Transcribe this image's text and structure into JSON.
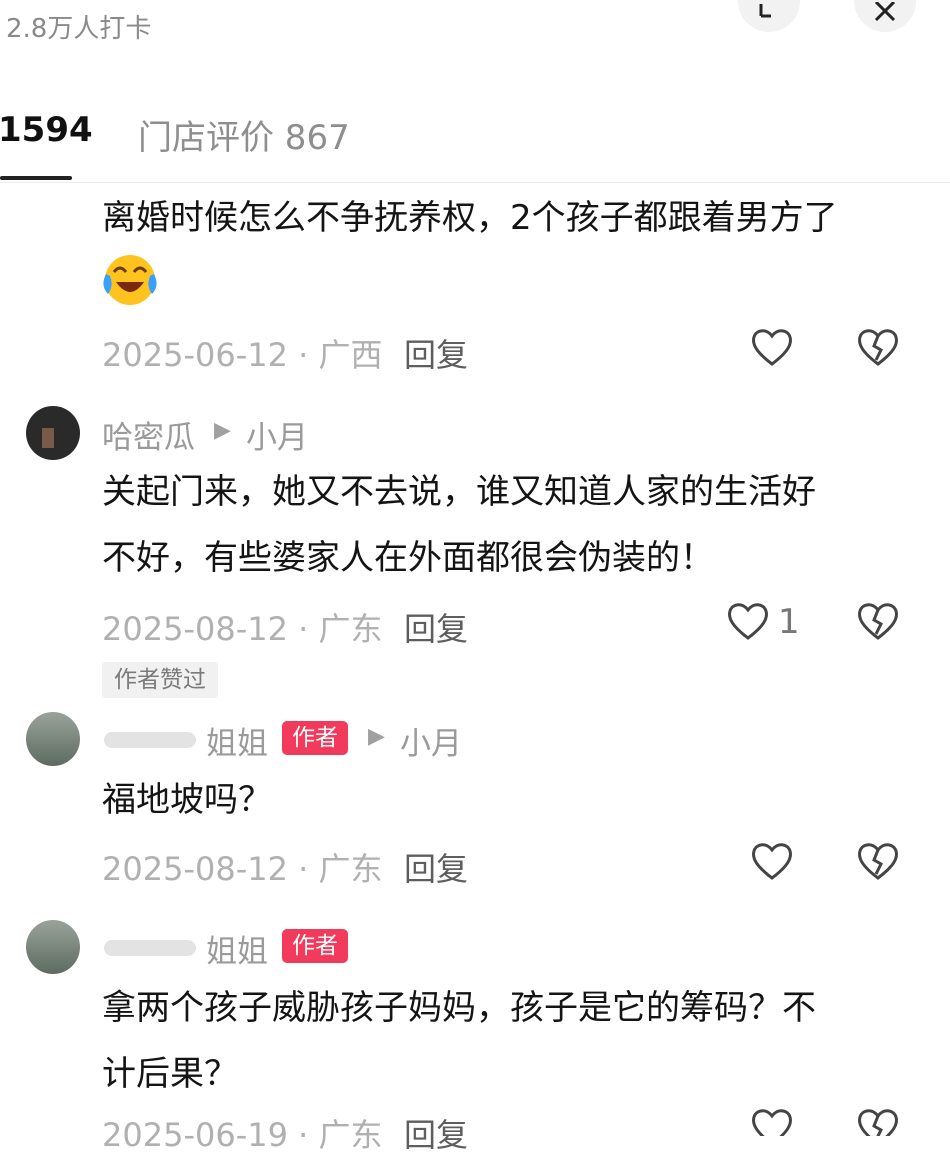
{
  "header": {
    "checkin_text": "2.8万人打卡",
    "share_icon": "share-icon",
    "close_icon": "close-icon",
    "tabs": [
      {
        "label": "1594"
      },
      {
        "label": "门店评价 867"
      }
    ]
  },
  "comments": [
    {
      "text_lines": [
        "离婚时候怎么不争抚养权，2个孩子都跟着男方了"
      ],
      "emoji": "crying-laughing-emoji",
      "date": "2025-06-12 · 广西",
      "reply": "回复",
      "likes": ""
    },
    {
      "author": "哈密瓜",
      "reply_to": "小月",
      "text_lines": [
        "关起门来，她又不去说，谁又知道人家的生活好",
        "不好，有些婆家人在外面都很会伪装的！"
      ],
      "date": "2025-08-12 · 广东",
      "reply": "回复",
      "likes": "1",
      "badge": "作者赞过"
    },
    {
      "author": "姐姐",
      "author_tag": "作者",
      "reply_to": "小月",
      "text_lines": [
        "福地坡吗？"
      ],
      "date": "2025-08-12 · 广东",
      "reply": "回复",
      "likes": ""
    },
    {
      "author": "姐姐",
      "author_tag": "作者",
      "text_lines": [
        "拿两个孩子威胁孩子妈妈，孩子是它的筹码？不",
        "计后果？"
      ],
      "date": "2025-06-19 · 广东",
      "reply": "回复",
      "likes": ""
    }
  ],
  "colors": {
    "accent": "#f23a5c",
    "meta_text": "#b0b0b0"
  }
}
